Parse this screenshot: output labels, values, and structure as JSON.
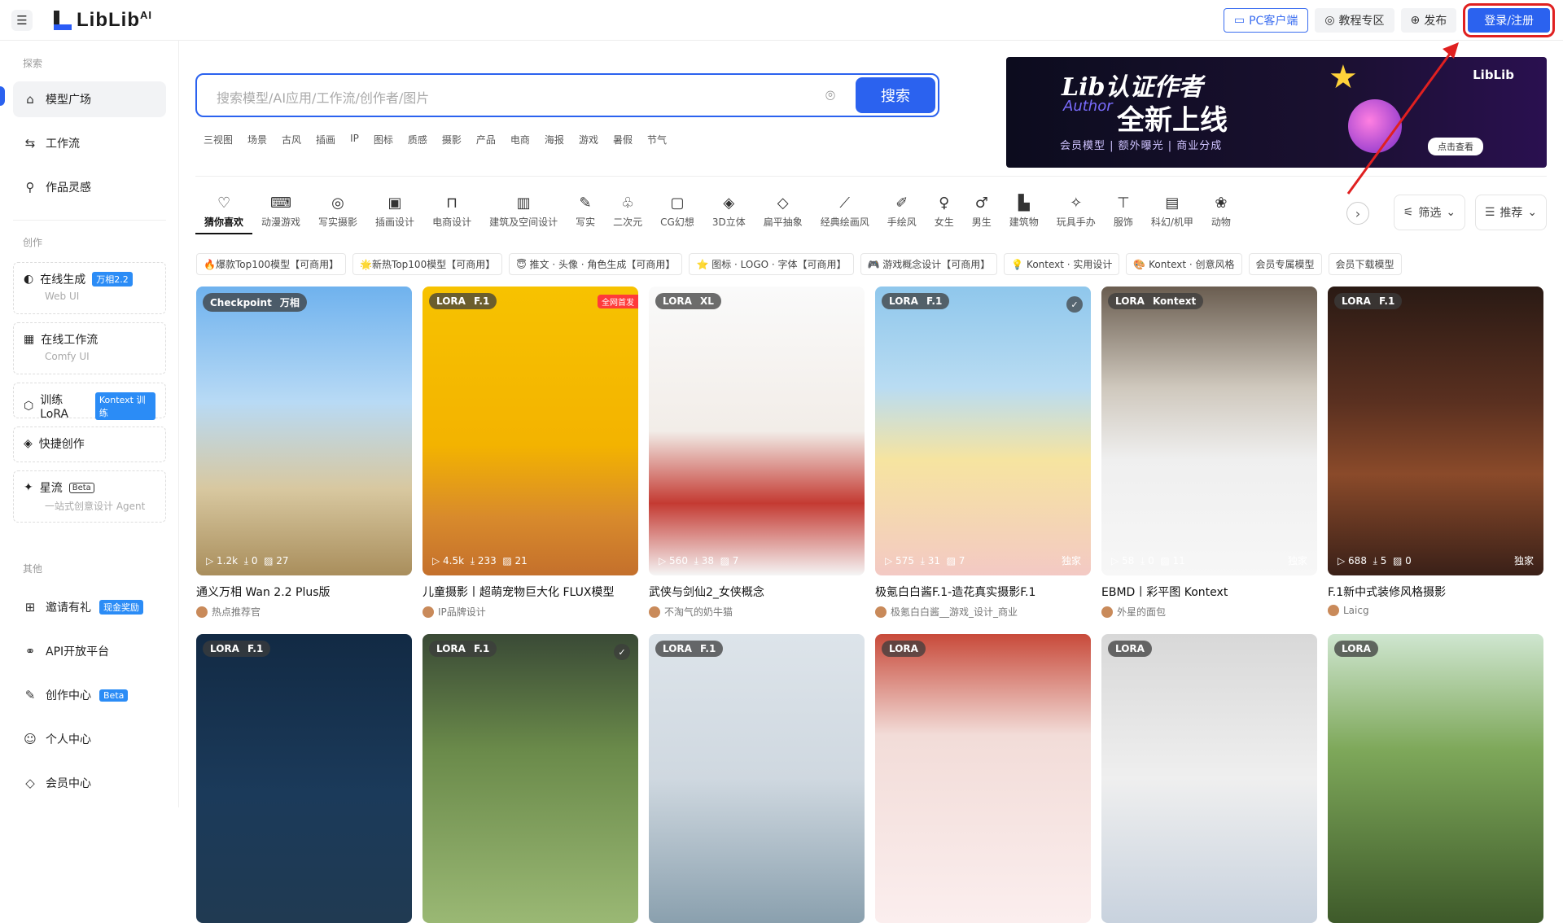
{
  "header": {
    "logo_text": "LibLib",
    "logo_suffix": "AI",
    "pc_client": "PC客户端",
    "tutorials": "教程专区",
    "publish": "发布",
    "login": "登录/注册"
  },
  "sidebar": {
    "section_explore": "探索",
    "nav": [
      {
        "label": "模型广场",
        "icon": "home-icon"
      },
      {
        "label": "工作流",
        "icon": "workflow-icon"
      },
      {
        "label": "作品灵感",
        "icon": "bulb-icon"
      }
    ],
    "section_create": "创作",
    "create": [
      {
        "label": "在线生成",
        "tag": "万相2.2",
        "sub": "Web UI"
      },
      {
        "label": "在线工作流",
        "sub": "Comfy UI"
      },
      {
        "label": "训练LoRA",
        "tag": "Kontext 训练"
      },
      {
        "label": "快捷创作"
      },
      {
        "label": "星流",
        "tag": "Beta",
        "sub": "一站式创意设计 Agent"
      }
    ],
    "section_other": "其他",
    "other": [
      {
        "label": "邀请有礼",
        "tag": "现金奖励"
      },
      {
        "label": "API开放平台"
      },
      {
        "label": "创作中心",
        "tag": "Beta"
      },
      {
        "label": "个人中心"
      },
      {
        "label": "会员中心"
      }
    ]
  },
  "search": {
    "placeholder": "搜索模型/AI应用/工作流/创作者/图片",
    "button": "搜索",
    "hot_tags": [
      "三视图",
      "场景",
      "古风",
      "插画",
      "IP",
      "图标",
      "质感",
      "摄影",
      "产品",
      "电商",
      "海报",
      "游戏",
      "暑假",
      "节气"
    ]
  },
  "banner": {
    "line1": "Lib认证作者",
    "line2": "Author",
    "line3": "全新上线",
    "features": "会员模型 | 额外曝光 | 商业分成",
    "cta": "点击查看",
    "brand": "LibLib"
  },
  "categories": [
    {
      "label": "猜你喜欢",
      "icon": "heart-icon",
      "glyph": "♡"
    },
    {
      "label": "动漫游戏",
      "icon": "gamepad-icon",
      "glyph": "⌨"
    },
    {
      "label": "写实摄影",
      "icon": "camera-icon",
      "glyph": "◎"
    },
    {
      "label": "插画设计",
      "icon": "image-icon",
      "glyph": "▣"
    },
    {
      "label": "电商设计",
      "icon": "bag-icon",
      "glyph": "⊓"
    },
    {
      "label": "建筑及空间设计",
      "icon": "building-icon",
      "glyph": "▥"
    },
    {
      "label": "写实",
      "icon": "pen-icon",
      "glyph": "✎"
    },
    {
      "label": "二次元",
      "icon": "drop-icon",
      "glyph": "♧"
    },
    {
      "label": "CG幻想",
      "icon": "cg-icon",
      "glyph": "▢"
    },
    {
      "label": "3D立体",
      "icon": "cube-icon",
      "glyph": "◈"
    },
    {
      "label": "扁平抽象",
      "icon": "diamond-icon",
      "glyph": "◇"
    },
    {
      "label": "经典绘画风",
      "icon": "brush-icon",
      "glyph": "⟋"
    },
    {
      "label": "手绘风",
      "icon": "pencil-icon",
      "glyph": "✐"
    },
    {
      "label": "女生",
      "icon": "female-icon",
      "glyph": "♀"
    },
    {
      "label": "男生",
      "icon": "male-icon",
      "glyph": "♂"
    },
    {
      "label": "建筑物",
      "icon": "tower-icon",
      "glyph": "▙"
    },
    {
      "label": "玩具手办",
      "icon": "puzzle-icon",
      "glyph": "✧"
    },
    {
      "label": "服饰",
      "icon": "shirt-icon",
      "glyph": "⊤"
    },
    {
      "label": "科幻/机甲",
      "icon": "robot-icon",
      "glyph": "▤"
    },
    {
      "label": "动物",
      "icon": "paw-icon",
      "glyph": "❀"
    }
  ],
  "filter": "筛选",
  "sort": "推荐",
  "chips": [
    "🔥爆款Top100模型【可商用】",
    "🌟新热Top100模型【可商用】",
    "😇 推文 · 头像 · 角色生成【可商用】",
    "⭐ 图标 · LOGO · 字体【可商用】",
    "🎮 游戏概念设计【可商用】",
    "💡 Kontext · 实用设计",
    "🎨 Kontext · 创意风格",
    "会员专属模型",
    "会员下载模型"
  ],
  "cards": [
    {
      "type": "Checkpoint",
      "base": "万相",
      "plays": "1.2k",
      "downloads": "0",
      "images": "27",
      "title": "通义万相 Wan 2.2 Plus版",
      "author": "热点推荐官",
      "excl": "",
      "bg": "linear-gradient(180deg,#6fb2ee 0%,#b8daf5 40%,#d8c8a0 70%,#a98e5c 100%)"
    },
    {
      "type": "LORA",
      "base": "F.1",
      "plays": "4.5k",
      "downloads": "233",
      "images": "21",
      "title": "儿童摄影丨超萌宠物巨大化 FLUX模型",
      "author": "IP品牌设计",
      "excl": "",
      "newtag": "全网首发",
      "bg": "linear-gradient(180deg,#f7c200 0%,#f3b300 55%,#d88a2c 80%,#c4702c 100%)"
    },
    {
      "type": "LORA",
      "base": "XL",
      "plays": "560",
      "downloads": "38",
      "images": "7",
      "title": "武侠与剑仙2_女侠概念",
      "author": "不淘气的奶牛猫",
      "excl": "",
      "bg": "linear-gradient(180deg,#fafafa 0%,#f2ede8 50%,#c43a32 75%,#f5f5f5 100%)"
    },
    {
      "type": "LORA",
      "base": "F.1",
      "plays": "575",
      "downloads": "31",
      "images": "7",
      "title": "极氪白白酱F.1-造花真实摄影F.1",
      "author": "极氪白白酱__游戏_设计_商业",
      "excl": "独家",
      "shield": true,
      "bg": "linear-gradient(180deg,#8fc7ec 0%,#b9dcf2 35%,#f6e4a0 60%,#f3c9c4 100%)"
    },
    {
      "type": "LORA",
      "base": "Kontext",
      "plays": "58",
      "downloads": "0",
      "images": "11",
      "title": "EBMD丨彩平图 Kontext",
      "author": "外星的面包",
      "excl": "独家",
      "bg": "linear-gradient(180deg,#6a5d50 0%,#cfc8bd 35%,#efefef 60%,#f7f7f7 100%)"
    },
    {
      "type": "LORA",
      "base": "F.1",
      "plays": "688",
      "downloads": "5",
      "images": "0",
      "title": "F.1新中式装修风格摄影",
      "author": "Laicg",
      "excl": "独家",
      "bg": "linear-gradient(180deg,#2a1a14 0%,#5a3020 40%,#8a4a2a 65%,#3a2018 100%)"
    },
    {
      "type": "LORA",
      "base": "F.1",
      "plays": "",
      "downloads": "",
      "images": "",
      "title": "",
      "author": "",
      "excl": "",
      "bg": "linear-gradient(180deg,#122a44 0%,#1b3a5a 55%,#203a52 100%)"
    },
    {
      "type": "LORA",
      "base": "F.1",
      "plays": "",
      "downloads": "",
      "images": "",
      "title": "",
      "author": "",
      "excl": "",
      "shield": true,
      "bg": "linear-gradient(180deg,#3a4a36 0%,#6a8a4a 40%,#9ab874 100%)"
    },
    {
      "type": "LORA",
      "base": "F.1",
      "plays": "",
      "downloads": "",
      "images": "",
      "title": "",
      "author": "",
      "excl": "",
      "bg": "linear-gradient(180deg,#dde4ea 0%,#cfd8e0 50%,#8aa0ae 100%)"
    },
    {
      "type": "LORA",
      "base": "",
      "plays": "",
      "downloads": "",
      "images": "",
      "title": "",
      "author": "",
      "excl": "",
      "bg": "linear-gradient(180deg,#c84a3a 0%,#f2dcd8 35%,#fbeeee 100%)"
    },
    {
      "type": "LORA",
      "base": "",
      "plays": "",
      "downloads": "",
      "images": "",
      "title": "",
      "author": "",
      "excl": "",
      "bg": "linear-gradient(180deg,#d8d8d8 0%,#efefef 50%,#c8d2de 100%)"
    },
    {
      "type": "LORA",
      "base": "",
      "plays": "",
      "downloads": "",
      "images": "",
      "title": "",
      "author": "",
      "excl": "",
      "bg": "linear-gradient(180deg,#cfe6d0 0%,#7ea85a 40%,#3e5a2a 100%)"
    }
  ],
  "colors": {
    "accent": "#2b62ef",
    "highlight": "#e02020"
  }
}
